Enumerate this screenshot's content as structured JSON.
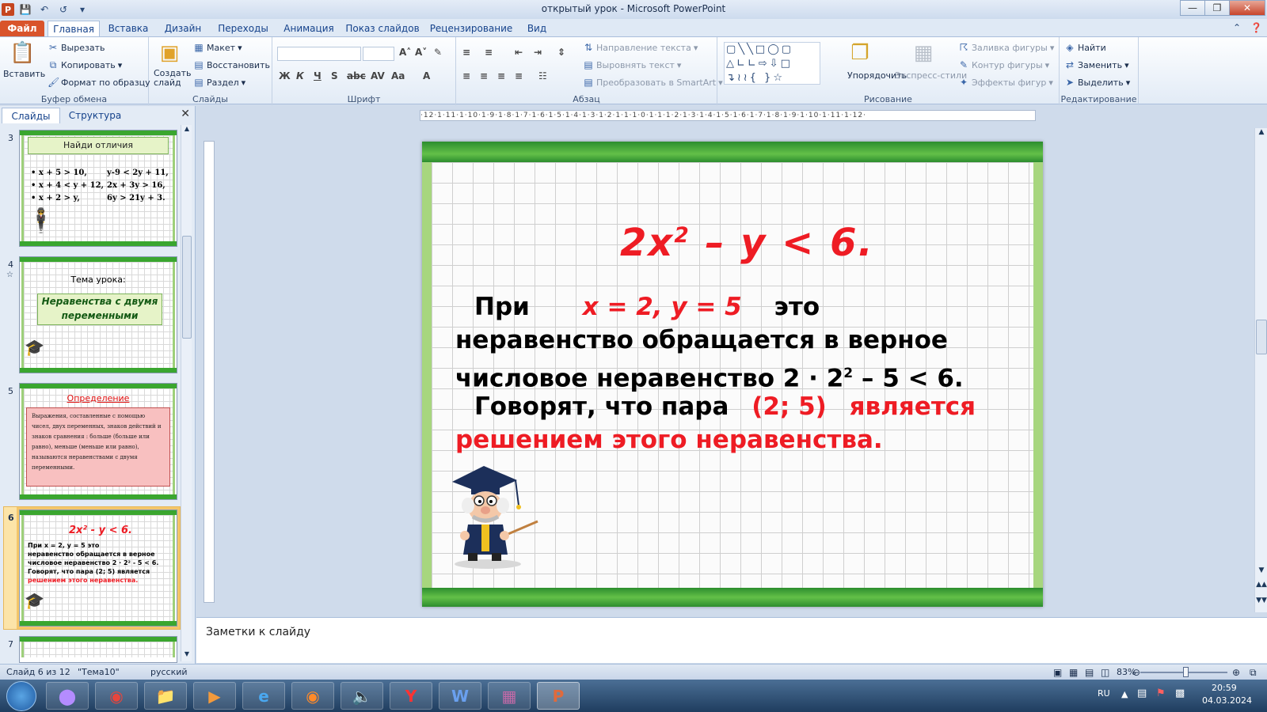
{
  "window": {
    "title": "открытый урок  -  Microsoft PowerPoint"
  },
  "tabs": [
    {
      "label": "Файл"
    },
    {
      "label": "Главная"
    },
    {
      "label": "Вставка"
    },
    {
      "label": "Дизайн"
    },
    {
      "label": "Переходы"
    },
    {
      "label": "Анимация"
    },
    {
      "label": "Показ слайдов"
    },
    {
      "label": "Рецензирование"
    },
    {
      "label": "Вид"
    }
  ],
  "ribbon": {
    "clipboard": {
      "label": "Буфер обмена",
      "paste": "Вставить",
      "cut": "Вырезать",
      "copy": "Копировать",
      "format_painter": "Формат по образцу"
    },
    "slides": {
      "label": "Слайды",
      "new_slide": "Создать слайд",
      "layout": "Макет",
      "reset": "Восстановить",
      "section": "Раздел"
    },
    "font": {
      "label": "Шрифт"
    },
    "paragraph": {
      "label": "Абзац",
      "text_direction": "Направление текста",
      "align_text": "Выровнять текст",
      "smartart": "Преобразовать в SmartArt"
    },
    "drawing": {
      "label": "Рисование",
      "arrange": "Упорядочить",
      "quick_styles": "Экспресс-стили",
      "shape_fill": "Заливка фигуры",
      "shape_outline": "Контур фигуры",
      "shape_effects": "Эффекты фигур"
    },
    "editing": {
      "label": "Редактирование",
      "find": "Найти",
      "replace": "Заменить",
      "select": "Выделить"
    }
  },
  "pane": {
    "tabs": [
      "Слайды",
      "Структура"
    ],
    "thumbs": [
      {
        "num": "3",
        "title": "Найди отличия",
        "lines": [
          "• x + 5 > 10,",
          "• x + 4 < y + 12,",
          "• x + 2 > y,"
        ],
        "lines2": [
          "y-9 < 2y + 11,",
          "2x + 3y > 16,",
          "6y > 21y + 3."
        ]
      },
      {
        "num": "4",
        "subtitle": "Тема урока:",
        "title": "Неравенства с двумя переменными"
      },
      {
        "num": "5",
        "title": "Определение",
        "body": "Выражения, составленные с помощью чисел, двух переменных, знаков действий и знаков сравнения : больше (больше или равно), меньше (меньше или равно), называются неравенствами с двумя переменными."
      },
      {
        "num": "6",
        "formula": "2x² - y < 6.",
        "lines": [
          "При    x = 2,  y = 5   это",
          "неравенство обращается в верное",
          "числовое неравенство  2 · 2² - 5 < 6.",
          "  Говорят, что пара  (2; 5)  является",
          "решением этого  неравенства."
        ]
      },
      {
        "num": "7"
      }
    ]
  },
  "slide": {
    "formula_a": "2x",
    "formula_sup": "2",
    "formula_b": " – y < 6.",
    "line1_a": "При",
    "line1_vals": "x = 2,  y = 5",
    "line1_b": "это",
    "line2": "неравенство обращается в верное",
    "line3_a": "числовое неравенство  2 · 2",
    "line3_sup": "2",
    "line3_b": " – 5 < 6.",
    "line4_a": "Говорят, что пара",
    "line4_pair": "(2; 5)",
    "line4_b": "является",
    "line5": "решением этого неравенства."
  },
  "notes": {
    "placeholder": "Заметки к слайду"
  },
  "status": {
    "slide_of": "Слайд 6 из 12",
    "theme": "\"Тема10\"",
    "language": "русский",
    "zoom": "83%"
  },
  "tray": {
    "lang": "RU",
    "time": "20:59",
    "date": "04.03.2024"
  }
}
